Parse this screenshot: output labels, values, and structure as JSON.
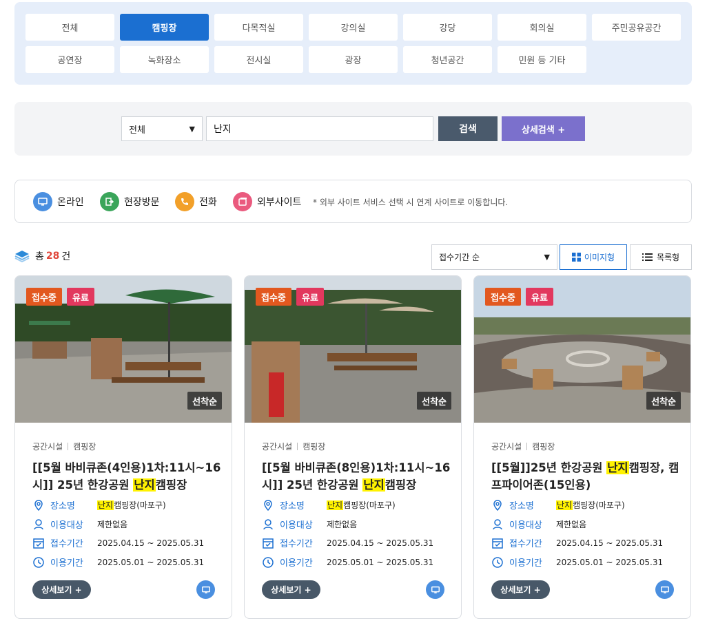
{
  "categories": [
    {
      "label": "전체",
      "active": false
    },
    {
      "label": "캠핑장",
      "active": true
    },
    {
      "label": "다목적실",
      "active": false
    },
    {
      "label": "강의실",
      "active": false
    },
    {
      "label": "강당",
      "active": false
    },
    {
      "label": "회의실",
      "active": false
    },
    {
      "label": "주민공유공간",
      "active": false
    },
    {
      "label": "공연장",
      "active": false
    },
    {
      "label": "녹화장소",
      "active": false
    },
    {
      "label": "전시실",
      "active": false
    },
    {
      "label": "광장",
      "active": false
    },
    {
      "label": "청년공간",
      "active": false
    },
    {
      "label": "민원 등 기타",
      "active": false
    }
  ],
  "search": {
    "scope_value": "전체",
    "query": "난지",
    "search_label": "검색",
    "advanced_label": "상세검색 +"
  },
  "legend": {
    "online": "온라인",
    "visit": "현장방문",
    "phone": "전화",
    "external": "외부사이트",
    "note": "* 외부 사이트 서비스 선택 시 연계 사이트로 이동합니다."
  },
  "summary": {
    "prefix": "총",
    "count": "28",
    "suffix": "건"
  },
  "sort": {
    "value": "접수기간 순",
    "image_view": "이미지형",
    "list_view": "목록형"
  },
  "cards": [
    {
      "badge_status": "접수중",
      "badge_fee": "유료",
      "first_come": "선착순",
      "type": "공간시설",
      "category": "캠핑장",
      "title_before": "[[5월 바비큐존(4인용)1차:11시~16시]] 25년 한강공원 ",
      "title_highlight": "난지",
      "title_after": "캠핑장",
      "place_label": "장소명",
      "place_highlight": "난지",
      "place_rest": "캠핑장(마포구)",
      "target_label": "이용대상",
      "target_value": "제한없음",
      "receipt_label": "접수기간",
      "receipt_value": "2025.04.15 ~ 2025.05.31",
      "use_label": "이용기간",
      "use_value": "2025.05.01 ~ 2025.05.31",
      "detail_label": "상세보기 +"
    },
    {
      "badge_status": "접수중",
      "badge_fee": "유료",
      "first_come": "선착순",
      "type": "공간시설",
      "category": "캠핑장",
      "title_before": "[[5월 바비큐존(8인용)1차:11시~16시]] 25년 한강공원 ",
      "title_highlight": "난지",
      "title_after": "캠핑장",
      "place_label": "장소명",
      "place_highlight": "난지",
      "place_rest": "캠핑장(마포구)",
      "target_label": "이용대상",
      "target_value": "제한없음",
      "receipt_label": "접수기간",
      "receipt_value": "2025.04.15 ~ 2025.05.31",
      "use_label": "이용기간",
      "use_value": "2025.05.01 ~ 2025.05.31",
      "detail_label": "상세보기 +"
    },
    {
      "badge_status": "접수중",
      "badge_fee": "유료",
      "first_come": "선착순",
      "type": "공간시설",
      "category": "캠핑장",
      "title_before": "[[5월]]25년 한강공원 ",
      "title_highlight": "난지",
      "title_after": "캠핑장, 캠프파이어존(15인용)",
      "place_label": "장소명",
      "place_highlight": "난지",
      "place_rest": "캠핑장(마포구)",
      "target_label": "이용대상",
      "target_value": "제한없음",
      "receipt_label": "접수기간",
      "receipt_value": "2025.04.15 ~ 2025.05.31",
      "use_label": "이용기간",
      "use_value": "2025.05.01 ~ 2025.05.31",
      "detail_label": "상세보기 +"
    }
  ],
  "colors": {
    "primary": "#1b6fd1",
    "accent_purple": "#7b70cc",
    "status_orange": "#e2581f",
    "fee_pink": "#e2385e",
    "highlight": "#fff200",
    "count_red": "#e0473b"
  }
}
